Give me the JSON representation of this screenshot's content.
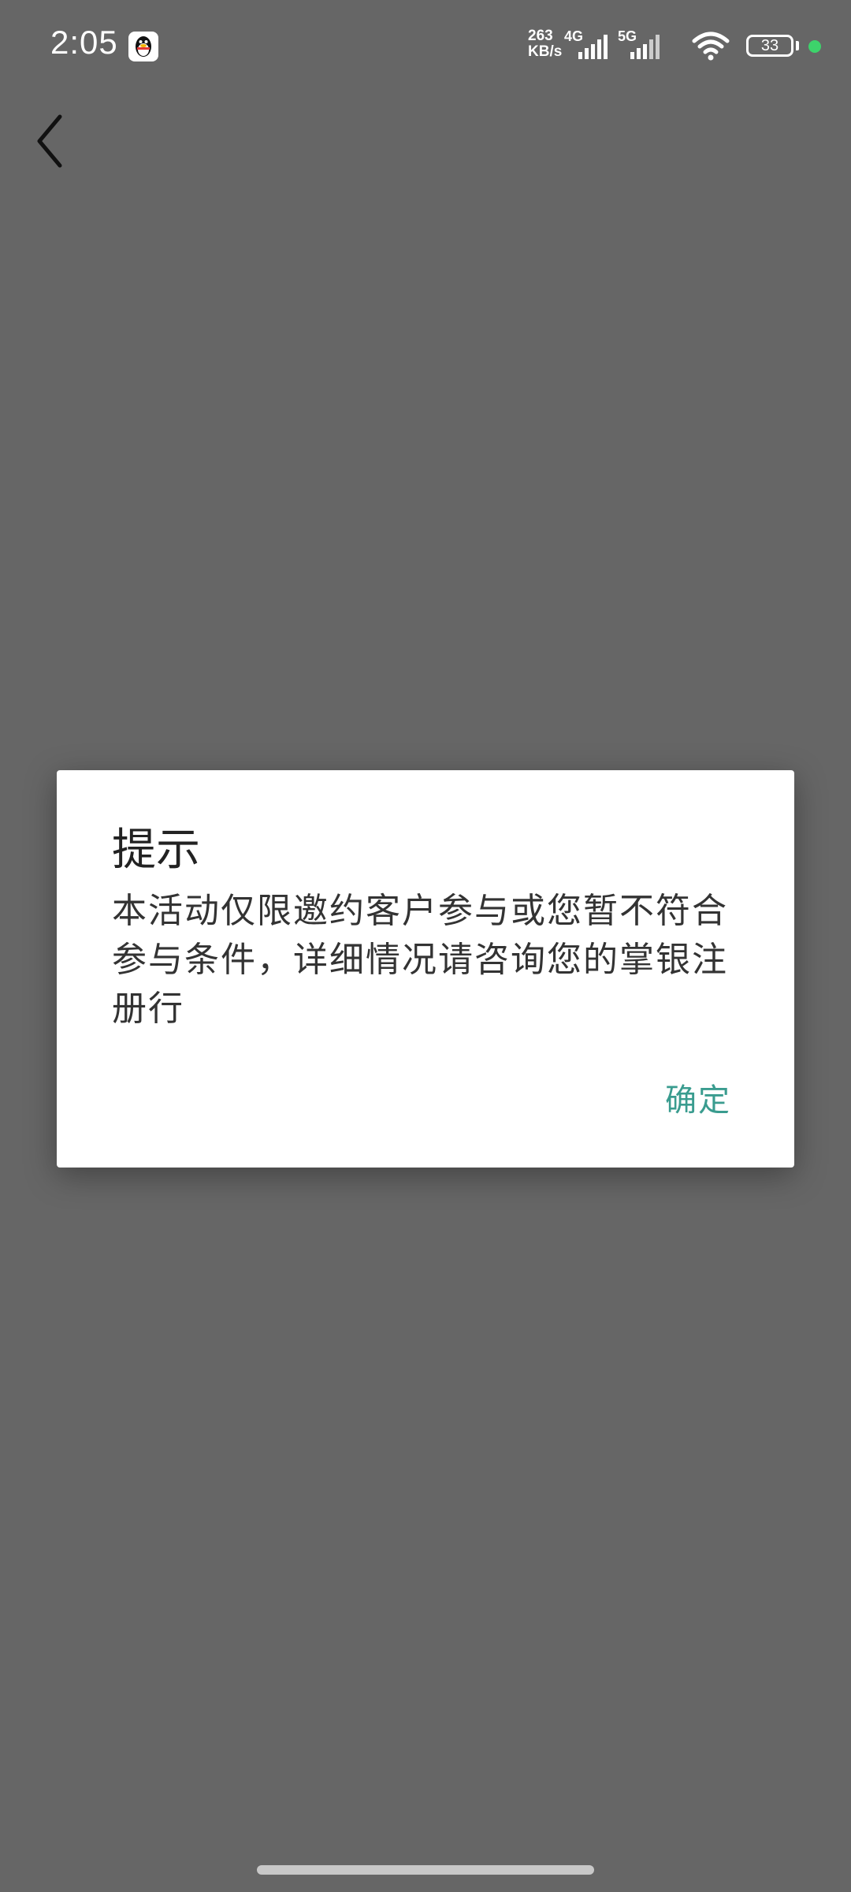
{
  "status_bar": {
    "time": "2:05",
    "net_speed_value": "263",
    "net_speed_unit": "KB/s",
    "signal1_label": "4G",
    "signal2_label": "5G",
    "battery_level": "33",
    "qq_icon": "qq-penguin-icon",
    "wifi_icon": "wifi-icon",
    "indicator_color": "#3dd36b"
  },
  "header": {
    "back_icon": "chevron-left-icon"
  },
  "dialog": {
    "title": "提示",
    "message": "本活动仅限邀约客户参与或您暂不符合参与条件，详细情况请咨询您的掌银注册行",
    "ok_label": "确定",
    "ok_color": "#3a9c8f"
  }
}
